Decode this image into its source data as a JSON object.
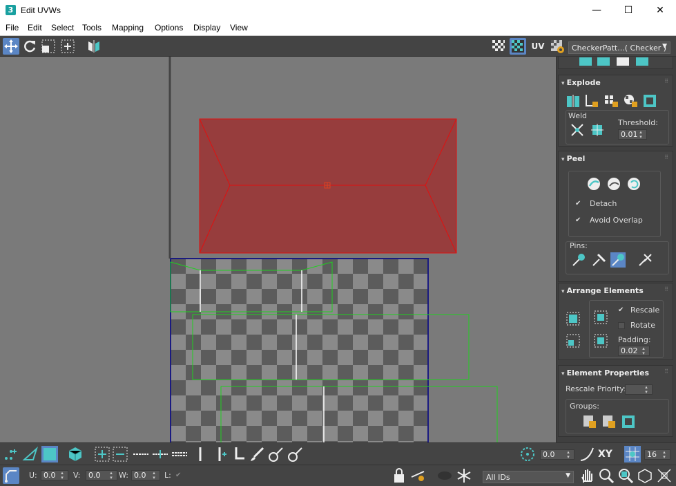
{
  "window": {
    "app_icon": "3",
    "title": "Edit UVWs",
    "minimize": "—",
    "maximize": "☐",
    "close": "✕"
  },
  "menu": [
    "File",
    "Edit",
    "Select",
    "Tools",
    "Mapping",
    "Options",
    "Display",
    "View"
  ],
  "toolbar": {
    "uv_label": "UV",
    "texture_dropdown": "CheckerPatt...( Checker )"
  },
  "panel": {
    "explode": {
      "title": "Explode",
      "weld_label": "Weld",
      "threshold_label": "Threshold:",
      "threshold_value": "0.01"
    },
    "peel": {
      "title": "Peel",
      "detach_label": "Detach",
      "detach_checked": true,
      "avoid_overlap_label": "Avoid Overlap",
      "avoid_overlap_checked": true,
      "pins_label": "Pins:"
    },
    "arrange": {
      "title": "Arrange Elements",
      "rescale_label": "Rescale",
      "rescale_checked": true,
      "rotate_label": "Rotate",
      "rotate_checked": false,
      "padding_label": "Padding:",
      "padding_value": "0.02"
    },
    "element_props": {
      "title": "Element Properties",
      "rescale_priority_label": "Rescale Priority:",
      "rescale_priority_value": "",
      "groups_label": "Groups:"
    }
  },
  "bottom": {
    "angle_value": "0.0",
    "xy_label": "XY",
    "grid_value": "16"
  },
  "status": {
    "u_label": "U:",
    "u_value": "0.0",
    "v_label": "V:",
    "v_value": "0.0",
    "w_label": "W:",
    "w_value": "0.0",
    "l_label": "L:",
    "ids_dropdown": "All IDs"
  },
  "colors": {
    "accent": "#5b86c5",
    "icon_teal": "#4dc6c6",
    "selected_face": "#973d3d",
    "selected_edge": "#e01010",
    "uv_edge": "#20d020",
    "uv_border": "#1a1a80"
  }
}
